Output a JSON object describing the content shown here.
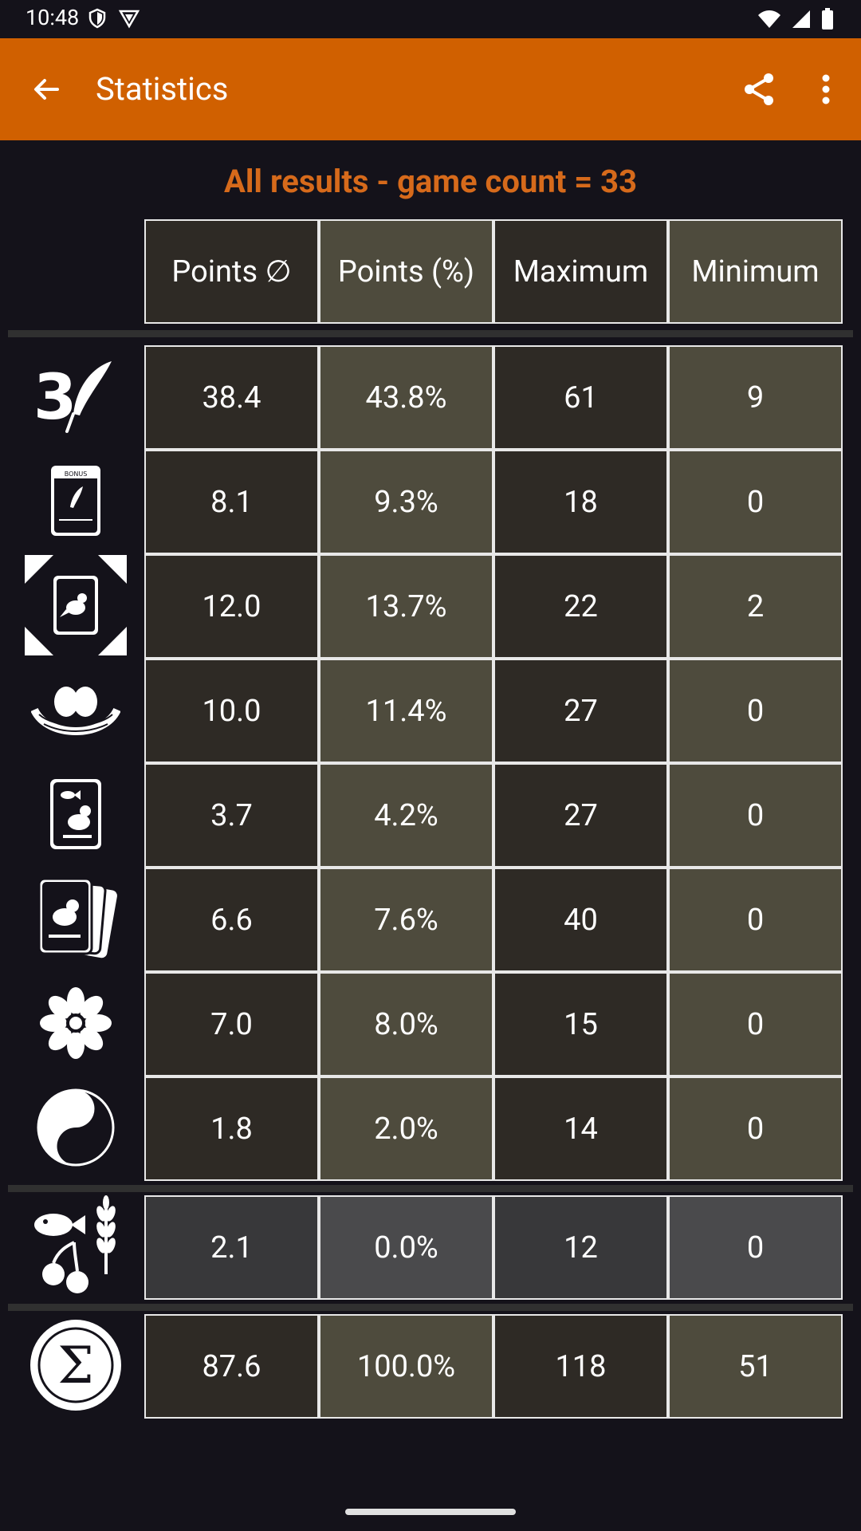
{
  "status": {
    "time": "10:48"
  },
  "app_bar": {
    "title": "Statistics"
  },
  "heading": "All results - game count = 33",
  "table": {
    "headers": [
      "Points ∅",
      "Points (%)",
      "Maximum",
      "Minimum"
    ],
    "rows": [
      {
        "icon": "feather-3-icon",
        "values": [
          "38.4",
          "43.8%",
          "61",
          "9"
        ]
      },
      {
        "icon": "bonus-card-icon",
        "values": [
          "8.1",
          "9.3%",
          "18",
          "0"
        ]
      },
      {
        "icon": "end-of-round-goal-icon",
        "values": [
          "12.0",
          "13.7%",
          "22",
          "2"
        ]
      },
      {
        "icon": "eggs-nest-icon",
        "values": [
          "10.0",
          "11.4%",
          "27",
          "0"
        ]
      },
      {
        "icon": "cached-food-card-icon",
        "values": [
          "3.7",
          "4.2%",
          "27",
          "0"
        ]
      },
      {
        "icon": "tucked-cards-icon",
        "values": [
          "6.6",
          "7.6%",
          "40",
          "0"
        ]
      },
      {
        "icon": "flower-icon",
        "values": [
          "7.0",
          "8.0%",
          "15",
          "0"
        ]
      },
      {
        "icon": "yin-yang-icon",
        "values": [
          "1.8",
          "2.0%",
          "14",
          "0"
        ]
      }
    ],
    "food_row": {
      "icon": "food-tokens-icon",
      "values": [
        "2.1",
        "0.0%",
        "12",
        "0"
      ]
    },
    "total_row": {
      "icon": "sigma-icon",
      "values": [
        "87.6",
        "100.0%",
        "118",
        "51"
      ]
    }
  },
  "colors": {
    "accent": "#d06000",
    "heading": "#d66a1b",
    "background": "#14121a"
  }
}
